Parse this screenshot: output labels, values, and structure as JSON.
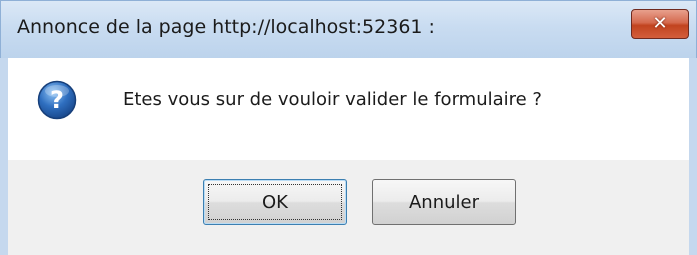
{
  "dialog": {
    "title": "Annonce de la page  http://localhost:52361  :",
    "close_label": "✕",
    "message": "Etes vous sur de vouloir valider le formulaire ?",
    "icon": "question-icon",
    "buttons": {
      "ok_label": "OK",
      "cancel_label": "Annuler"
    }
  },
  "colors": {
    "titlebar": "#c9dcf1",
    "close_button": "#c1431f",
    "icon_blue": "#2f6fc0",
    "button_area": "#f0f0f0"
  }
}
